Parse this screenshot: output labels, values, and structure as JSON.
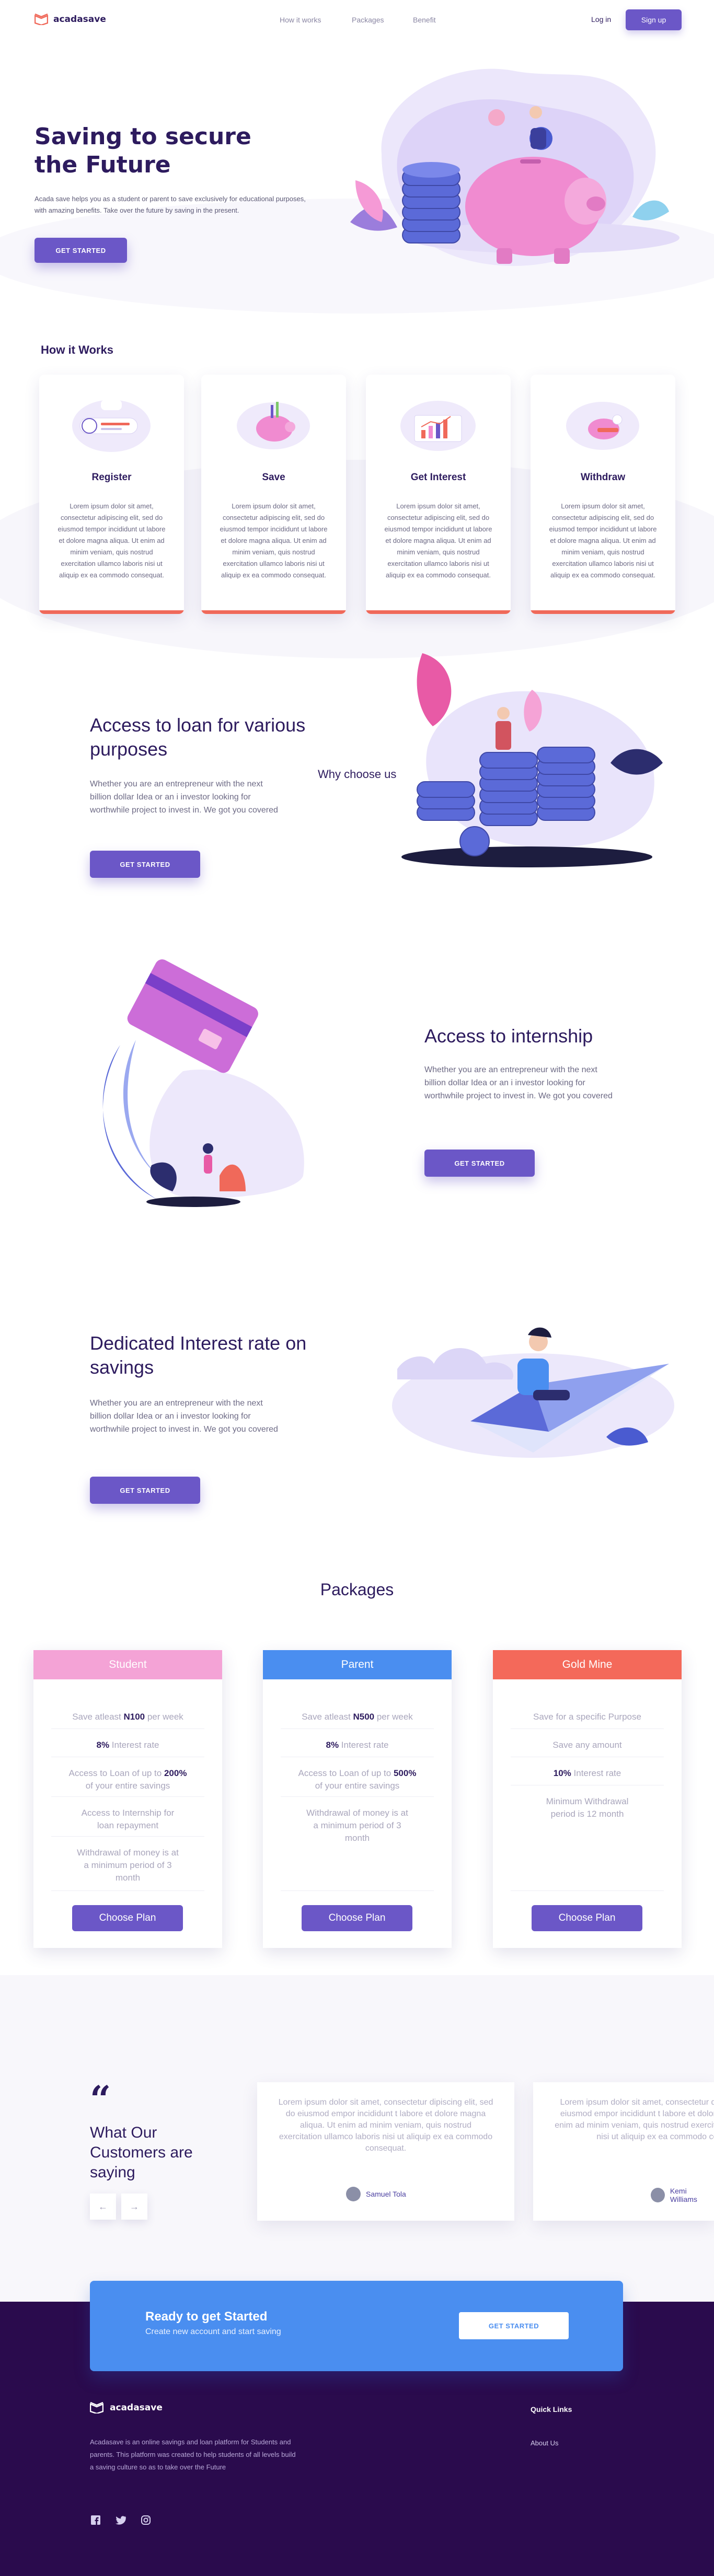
{
  "brand": {
    "name": "acadasave"
  },
  "nav": {
    "links": [
      "How it works",
      "Packages",
      "Benefit"
    ],
    "login": "Log in",
    "signup": "Sign up"
  },
  "hero": {
    "title_line1": "Saving to secure",
    "title_line2": "the Future",
    "subtitle": "Acada save helps you as a student or parent to save exclusively for educational purposes, with amazing benefits. Take over the future by saving in the present.",
    "cta": "GET STARTED"
  },
  "how": {
    "title": "How it Works",
    "lorem": "Lorem ipsum dolor sit amet, consectetur adipiscing elit, sed do eiusmod tempor incididunt ut labore et dolore magna aliqua. Ut enim ad minim veniam, quis nostrud exercitation ullamco laboris nisi ut aliquip ex ea commodo consequat.",
    "cards": [
      {
        "title": "Register",
        "icon": "register-illustration"
      },
      {
        "title": "Save",
        "icon": "piggy-bank-illustration"
      },
      {
        "title": "Get Interest",
        "icon": "interest-chart-illustration"
      },
      {
        "title": "Withdraw",
        "icon": "withdraw-illustration"
      }
    ]
  },
  "features": {
    "why": "Why choose us",
    "text": "Whether you are an entrepreneur with the next billion dollar Idea  or an i investor looking for worthwhile project to invest in. We got you covered",
    "cta": "GET STARTED",
    "items": [
      {
        "title": "Access to loan for various purposes"
      },
      {
        "title": "Access to internship"
      },
      {
        "title": "Dedicated Interest rate on savings"
      }
    ]
  },
  "packages": {
    "title": "Packages",
    "choose": "Choose Plan",
    "plans": [
      {
        "name": "Student",
        "color": "#f4a3d6",
        "l1a": "Save atleast ",
        "l1b": "N100",
        "l1c": " per week",
        "l2a": "8%",
        "l2b": " Interest rate",
        "l3a": "Access to Loan of up to ",
        "l3b": "200%",
        "l3c": "of your entire savings",
        "l4": "Access to Internship for loan repayment",
        "l5": "Withdrawal of money is at a minimum period of 3 month"
      },
      {
        "name": "Parent",
        "color": "#4a8ef0",
        "l1a": "Save atleast ",
        "l1b": "N500",
        "l1c": " per week",
        "l2a": "8%",
        "l2b": " Interest rate",
        "l3a": "Access to Loan of up to ",
        "l3b": "500%",
        "l3c": "of your entire savings",
        "l4": "Withdrawal of money is at a minimum period of 3 month"
      },
      {
        "name": "Gold Mine",
        "color": "#f4695a",
        "l1": "Save for a specific Purpose",
        "l2": "Save any amount",
        "l3a": "10%",
        "l3b": " Interest rate",
        "l4": "Minimum Withdrawal period is 12 month"
      }
    ]
  },
  "testimonials": {
    "title": "What Our Customers are saying",
    "quote": "Lorem ipsum dolor sit amet, consectetur dipiscing elit, sed do eiusmod empor incididunt t labore et dolore magna aliqua. Ut enim ad minim veniam, quis nostrud exercitation ullamco laboris nisi ut aliquip ex ea commodo consequat.",
    "quote2": "Lorem ipsum dolor sit amet, consectetur dipiscing elit, sed do eiusmod empor incididunt t labore et dolore magna aliqua. Ut enim ad minim veniam, quis nostrud exercitation ullamco laboris nisi ut aliquip ex ea commodo consequat.",
    "author1": "Samuel Tola",
    "author2": "Kemi Williams",
    "prev": "←",
    "next": "→"
  },
  "cta": {
    "title": "Ready to get Started",
    "subtitle": "Create new account and start saving",
    "button": "GET STARTED"
  },
  "footer": {
    "description": "Acadasave is an online savings and loan platform for Students and parents. This platform was created to help students of all levels build a saving culture so as to take over the Future",
    "quick_links": "Quick Links",
    "about": "About Us",
    "social": [
      "facebook-icon",
      "twitter-icon",
      "instagram-icon"
    ]
  }
}
